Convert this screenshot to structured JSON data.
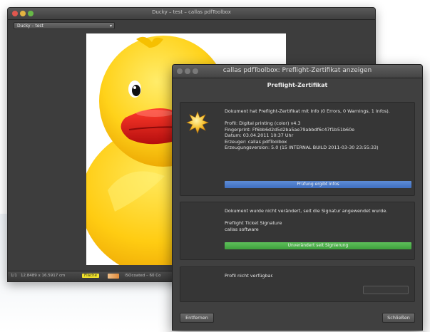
{
  "background_window": {
    "title": "Ducky – test – callas pdfToolbox",
    "document_selector": "Ducky – test",
    "status": {
      "page_indicator": "1/1",
      "page_size": "12.8489 x 16.5917 cm",
      "badge": "Fläche",
      "zoom_info": "ISOcoated – 60 Co"
    }
  },
  "dialog": {
    "title": "callas pdfToolbox: Preflight-Zertifikat anzeigen",
    "heading": "Preflight-Zertifikat",
    "certificate": {
      "summary": "Dokument hat Preflight-Zertifikat mit Info (0 Errors, 0 Warnings, 1 Infos).",
      "profile": "Profil: Digital printing (color) v4.3",
      "fingerprint": "Fingerprint: Ff6bb6d2d5d2ba5ae79abbdf6c47f1b51b60e",
      "date": "Datum: 03.04.2011 10:37 Uhr",
      "creator": "Erzeuger: callas pdfToolbox",
      "creator_version": "Erzeugungsversion: 5.0 (15 INTERNAL BUILD 2011-03-30 23:55:33)",
      "status_bar": "Prüfung ergibt Infos"
    },
    "signature": {
      "text": "Dokument wurde nicht verändert, seit die Signatur angewendet wurde.",
      "signer_name": "Preflight Ticket Signature",
      "signer_org": "callas software",
      "status_bar": "Unverändert seit Signierung"
    },
    "profile_section": {
      "text": "Profil nicht verfügbar."
    },
    "buttons": {
      "remove": "Entfernen",
      "close": "Schließen"
    }
  },
  "colors": {
    "info_bar": "#4a7ccb",
    "ok_bar": "#45a844",
    "badge": "#f1e22c"
  }
}
